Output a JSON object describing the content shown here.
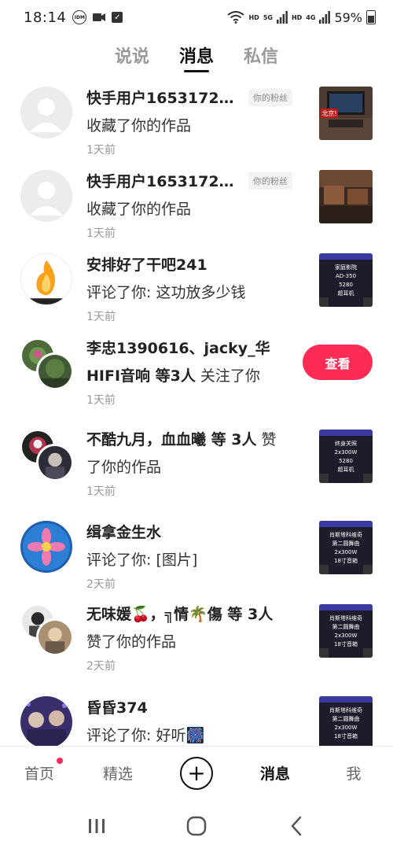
{
  "status_bar": {
    "time": "18:14",
    "icons": [
      "idm-icon",
      "video-icon",
      "check-icon",
      "wifi-icon",
      "hd-icon",
      "signal-5g-icon",
      "signal-4g-icon",
      "battery-icon"
    ],
    "hd1": "HD",
    "net1": "5G",
    "hd2": "HD",
    "net2": "4G",
    "battery": "59%"
  },
  "tabs": [
    {
      "label": "说说",
      "active": false
    },
    {
      "label": "消息",
      "active": true
    },
    {
      "label": "私信",
      "active": false
    }
  ],
  "notifications": [
    {
      "name": "快手用户16531723...",
      "badge": "你的粉丝",
      "action": "收藏了你的作品",
      "time": "1天前",
      "thumb_text": "北京!"
    },
    {
      "name": "快手用户16531723...",
      "badge": "你的粉丝",
      "action": "收藏了你的作品",
      "time": "1天前"
    },
    {
      "name": "安排好了干吧241",
      "action": "评论了你: 这功放多少钱",
      "time": "1天前",
      "thumb_lines": [
        "家庭影院",
        "AD-350",
        "5280",
        "超耳机"
      ]
    },
    {
      "names": "李忠1390616、jacky_华HIFI音响",
      "suffix": " 等3人",
      "action": " 关注了你",
      "time": "1天前"
    },
    {
      "names": "不酷九月，血血曦",
      "suffix": " 等 3人",
      "action": " 赞了你的作品",
      "time": "1天前",
      "thumb_lines": [
        "终身关照",
        "2x300W",
        "5280",
        "超耳机"
      ]
    },
    {
      "name": "缉拿金生水",
      "action": "评论了你: [图片]",
      "time": "2天前",
      "thumb_lines": [
        "肖斯塔科维奇",
        "第二圆舞曲",
        "2x300W",
        "18寸音箱"
      ]
    },
    {
      "names": "无味媛🍒，╗情🌴傷",
      "suffix": " 等 3人",
      "action": "赞了你的作品",
      "time": "2天前",
      "thumb_lines": [
        "肖斯塔科维奇",
        "第二圆舞曲",
        "2x300W",
        "18寸音箱"
      ]
    },
    {
      "name": "昏昏374",
      "action": "评论了你: 好听🎆",
      "time": "",
      "thumb_lines": [
        "肖斯塔科维奇",
        "第二圆舞曲",
        "2x300W",
        "18寸音箱"
      ]
    }
  ],
  "view_button": "查看",
  "bottom_nav": [
    {
      "label": "首页",
      "active": false,
      "has_dot": true
    },
    {
      "label": "精选",
      "active": false
    },
    {
      "label": "+",
      "icon": "plus-icon"
    },
    {
      "label": "消息",
      "active": true
    },
    {
      "label": "我",
      "active": false
    }
  ],
  "colors": {
    "accent": "#fe2c55",
    "text": "#222222",
    "muted": "#999999"
  }
}
